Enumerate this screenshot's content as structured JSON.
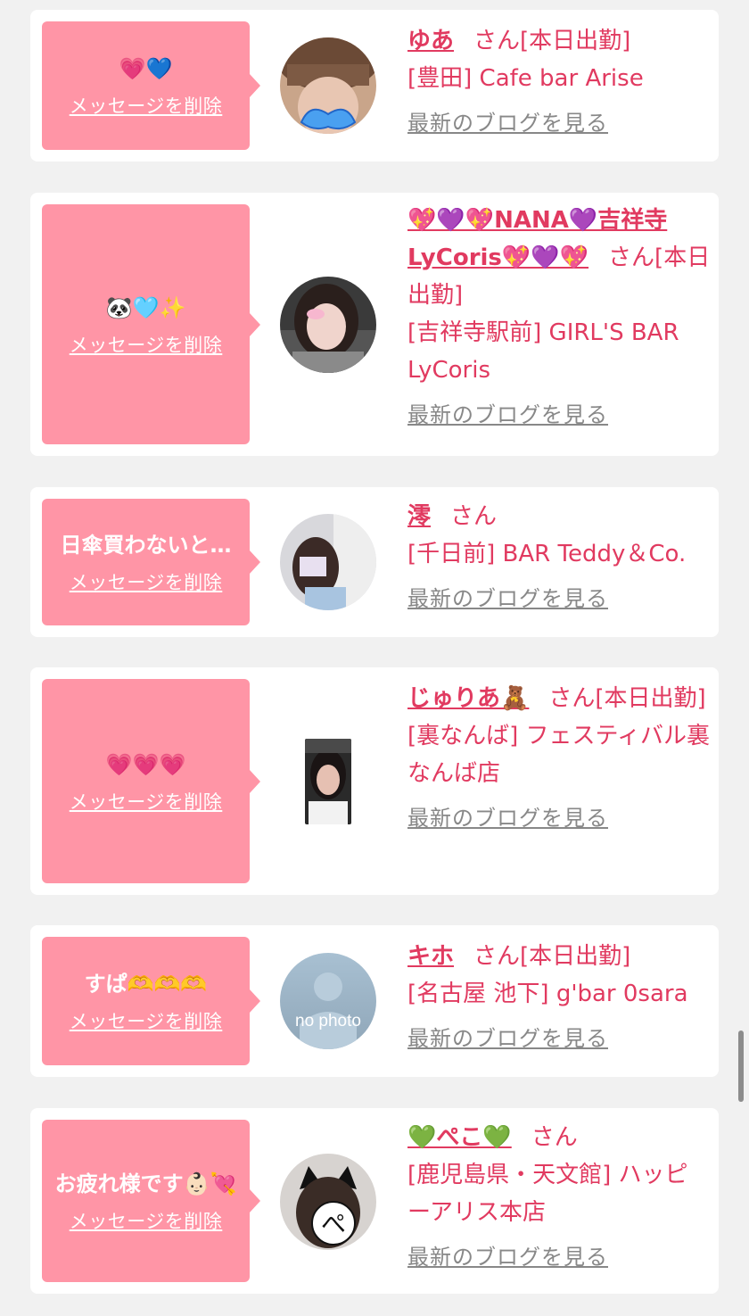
{
  "cards": [
    {
      "message": "💗💙",
      "delete_label": "メッセージを削除",
      "name": "ゆあ",
      "honorific": "さん",
      "status": "[本日出勤]",
      "shop": "[豊田] Cafe bar Arise",
      "blog_label": "最新のブログを見る"
    },
    {
      "message": "🐼🩵✨",
      "delete_label": "メッセージを削除",
      "name": "💖💜💖NANA💜吉祥寺LyCoris💖💜💖",
      "honorific": "さん",
      "status": "[本日出勤]",
      "shop": "[吉祥寺駅前] GIRL'S BAR LyCoris",
      "blog_label": "最新のブログを見る"
    },
    {
      "message": "日傘買わないと…",
      "delete_label": "メッセージを削除",
      "name": "澪",
      "honorific": "さん",
      "status": "",
      "shop": "[千日前] BAR Teddy＆Co.",
      "blog_label": "最新のブログを見る"
    },
    {
      "message": "💗💗💗",
      "delete_label": "メッセージを削除",
      "name": "じゅりあ🧸",
      "honorific": "さん",
      "status": "[本日出勤]",
      "shop": "[裏なんば] フェスティバル裏なんば店",
      "blog_label": "最新のブログを見る"
    },
    {
      "message": "すぱ🫶🫶🫶",
      "delete_label": "メッセージを削除",
      "name": "キホ",
      "honorific": "さん",
      "status": "[本日出勤]",
      "shop": "[名古屋 池下] g'bar 0sara",
      "blog_label": "最新のブログを見る",
      "avatar_text": "no photo"
    },
    {
      "message": "お疲れ様です👶🏻💘",
      "delete_label": "メッセージを削除",
      "name": "💚ぺこ💚",
      "honorific": "さん",
      "status": "",
      "shop": "[鹿児島県・天文館] ハッピーアリス本店",
      "blog_label": "最新のブログを見る",
      "avatar_text": "ぺ"
    }
  ]
}
